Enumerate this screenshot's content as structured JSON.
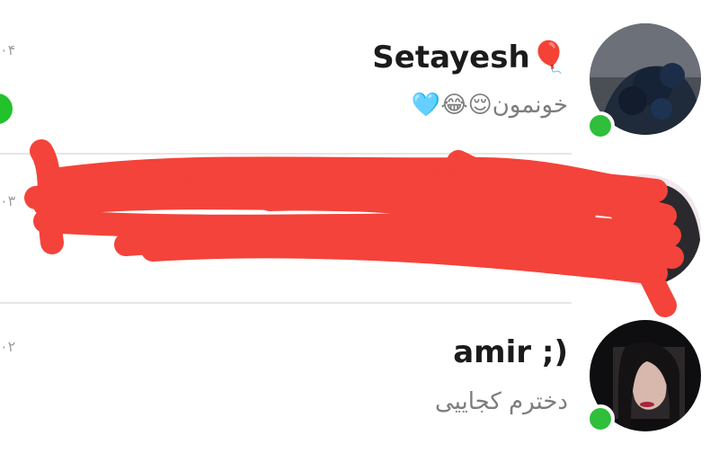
{
  "chats": [
    {
      "name": "Setayesh",
      "name_emoji": "🎈",
      "preview": "خونمون😌😂🩵",
      "time": "۰۴",
      "online": true,
      "unread": true
    },
    {
      "name": "",
      "preview": "",
      "time": "۰۳",
      "online": false,
      "unread": false,
      "redacted": true
    },
    {
      "name": "amir ;)",
      "preview": "دخترم کجاییی",
      "time": "۰۲",
      "online": true,
      "unread": false
    }
  ],
  "colors": {
    "online": "#2fbf3a",
    "unread": "#22c22a",
    "redaction": "#f4433a",
    "separator": "#e6e6e6"
  }
}
